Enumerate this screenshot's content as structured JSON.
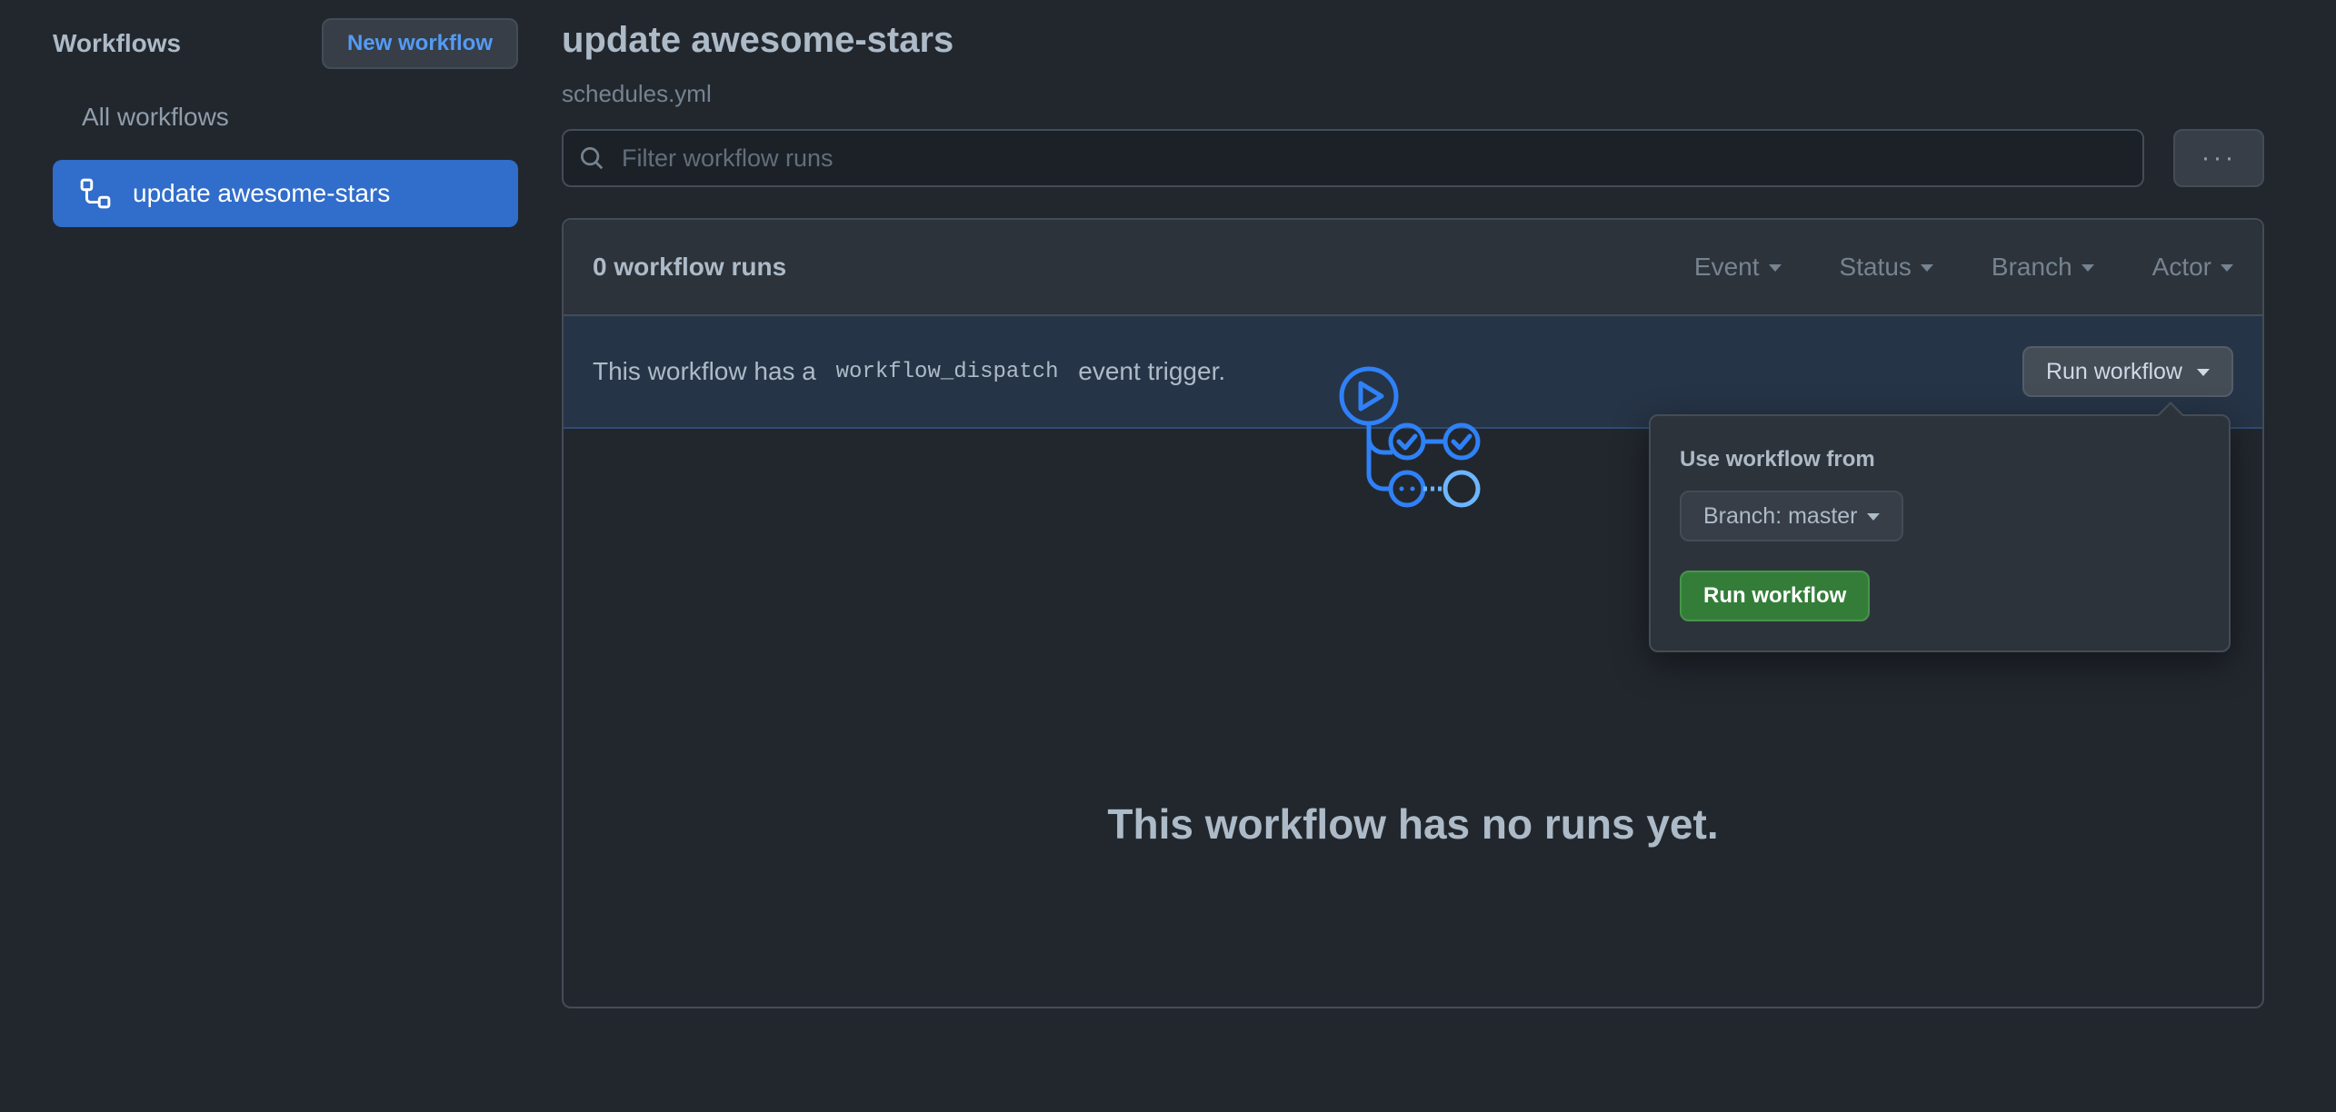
{
  "sidebar": {
    "title": "Workflows",
    "new_workflow_label": "New workflow",
    "items": [
      {
        "label": "All workflows",
        "active": false
      },
      {
        "label": "update awesome-stars",
        "active": true
      }
    ]
  },
  "header": {
    "title": "update awesome-stars",
    "subtitle": "schedules.yml"
  },
  "search": {
    "placeholder": "Filter workflow runs"
  },
  "more_button_label": "···",
  "runs": {
    "count_label": "0 workflow runs",
    "filters": [
      "Event",
      "Status",
      "Branch",
      "Actor"
    ]
  },
  "dispatch": {
    "text_before": "This workflow has a ",
    "code": "workflow_dispatch",
    "text_after": " event trigger.",
    "run_button_label": "Run workflow"
  },
  "popover": {
    "label": "Use workflow from",
    "branch_select": "Branch: master",
    "run_button_label": "Run workflow"
  },
  "empty_state": {
    "message": "This workflow has no runs yet."
  },
  "colors": {
    "background": "#22272e",
    "accent": "#316dca",
    "link": "#539bf5",
    "success": "#347d39"
  }
}
